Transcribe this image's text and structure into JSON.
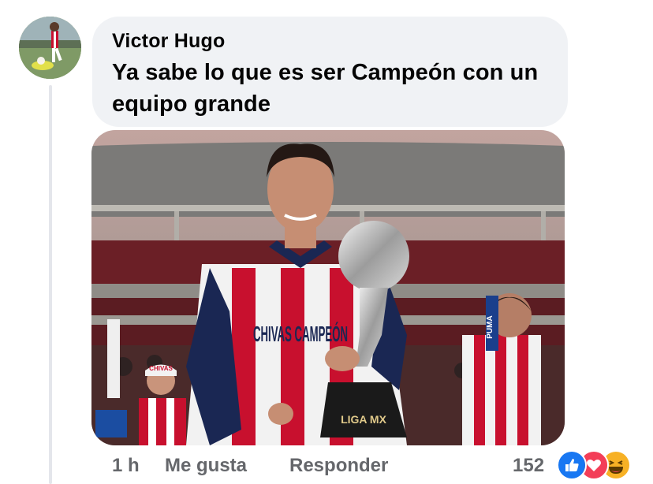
{
  "comment": {
    "author": "Victor Hugo",
    "text": "Ya sabe lo que es ser Campeón con un equipo grande",
    "avatar_icon": "avatar-photo",
    "attachment": {
      "description_icon": "photo-attachment",
      "jersey_text": "CHIVAS CAMPEÓN",
      "banner_text": "PUMA",
      "fan_cap_text": "CHIVAS",
      "trophy_base_text": "LIGA MX"
    }
  },
  "actions": {
    "time": "1 h",
    "like_label": "Me gusta",
    "reply_label": "Responder",
    "reaction_count": "152",
    "reaction_icons": [
      "like-reaction-icon",
      "love-reaction-icon",
      "haha-reaction-icon"
    ]
  },
  "colors": {
    "bubble_bg": "#f0f2f5",
    "text": "#050505",
    "secondary_text": "#65676b",
    "like_blue": "#1877f2",
    "love_red": "#f33e58",
    "haha_yellow": "#f7b125"
  }
}
